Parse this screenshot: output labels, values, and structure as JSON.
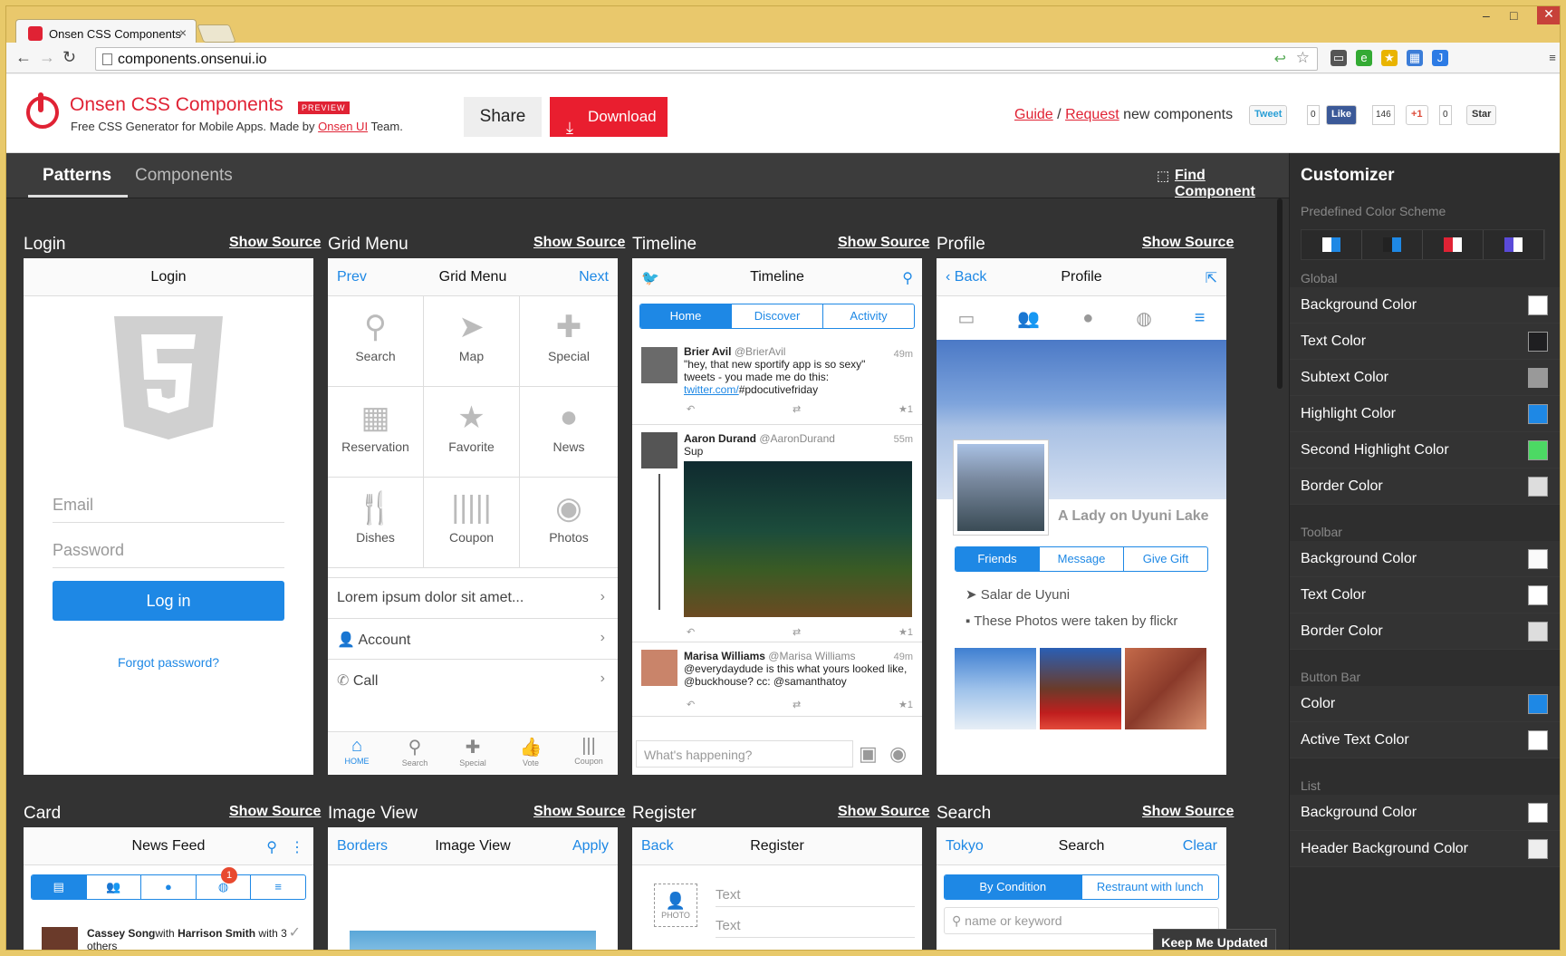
{
  "browser": {
    "tab_title": "Onsen CSS Components",
    "url": "components.onsenui.io"
  },
  "header": {
    "brand": "Onsen CSS Components",
    "preview": "PREVIEW",
    "tag_pre": "Free CSS Generator for Mobile Apps. Made by ",
    "tag_link": "Onsen UI",
    "tag_post": " Team.",
    "share": "Share",
    "download": "Download",
    "guide": "Guide",
    "sep": "/",
    "request": "Request",
    "request_post": " new components",
    "tweet": "Tweet",
    "tweet_count": "0",
    "like": "Like",
    "like_count": "146",
    "gplus": "+1",
    "gplus_count": "0",
    "star": "Star"
  },
  "nav": {
    "patterns": "Patterns",
    "components": "Components",
    "find": "Find Component"
  },
  "sections": {
    "show_source": "Show Source",
    "login": "Login",
    "grid": "Grid Menu",
    "timeline": "Timeline",
    "profile": "Profile",
    "card": "Card",
    "image": "Image View",
    "register": "Register",
    "search": "Search"
  },
  "login": {
    "title": "Login",
    "email": "Email",
    "password": "Password",
    "button": "Log in",
    "forgot": "Forgot password?"
  },
  "grid": {
    "prev": "Prev",
    "title": "Grid Menu",
    "next": "Next",
    "cells": [
      "Search",
      "Map",
      "Special",
      "Reservation",
      "Favorite",
      "News",
      "Dishes",
      "Coupon",
      "Photos"
    ],
    "list": [
      "Lorem ipsum dolor sit amet...",
      "Account",
      "Call"
    ],
    "tabs": [
      "HOME",
      "Search",
      "Special",
      "Vote",
      "Coupon"
    ]
  },
  "timeline": {
    "title": "Timeline",
    "segs": [
      "Home",
      "Discover",
      "Activity"
    ],
    "t1_name": "Brier Avil",
    "t1_handle": "@BrierAvil",
    "t1_time": "49m",
    "t1_text": "\"hey, that new sportify app is so sexy\" tweets - you made me do this:",
    "t1_link": "twitter.com/",
    "t1_tag": "#pdocutivefriday",
    "t2_name": "Aaron Durand",
    "t2_handle": "@AaronDurand",
    "t2_time": "55m",
    "t2_text": "Sup",
    "t3_name": "Marisa Williams",
    "t3_handle": "@Marisa Williams",
    "t3_time": "49m",
    "t3_text": "@everydaydude is this what yours looked like, @buckhouse? cc: @samanthatoy",
    "compose": "What's happening?",
    "star1": "★1"
  },
  "profile": {
    "back": "Back",
    "title": "Profile",
    "name": "A Lady on Uyuni Lake",
    "segs": [
      "Friends",
      "Message",
      "Give Gift"
    ],
    "loc": "Salar de Uyuni",
    "photos": "These Photos were taken by flickr"
  },
  "card": {
    "title": "News Feed",
    "badge": "1",
    "author": "Cassey Song",
    "with": "with",
    "other": "Harrison Smith",
    "tail": "with 3 others"
  },
  "imageview": {
    "left": "Borders",
    "title": "Image View",
    "right": "Apply"
  },
  "register": {
    "back": "Back",
    "title": "Register",
    "photo": "PHOTO",
    "f1": "Text",
    "f2": "Text"
  },
  "search": {
    "left": "Tokyo",
    "title": "Search",
    "right": "Clear",
    "segs": [
      "By Condition",
      "Restraunt with lunch"
    ],
    "placeholder": "name or keyword"
  },
  "customizer": {
    "title": "Customizer",
    "scheme_label": "Predefined Color Scheme",
    "global": "Global",
    "toolbar": "Toolbar",
    "buttonbar": "Button Bar",
    "list": "List",
    "global_rows": [
      {
        "label": "Background Color",
        "color": "#ffffff"
      },
      {
        "label": "Text Color",
        "color": "#1f1f21"
      },
      {
        "label": "Subtext Color",
        "color": "#999999"
      },
      {
        "label": "Highlight Color",
        "color": "#1e88e5"
      },
      {
        "label": "Second Highlight Color",
        "color": "#4cd964"
      },
      {
        "label": "Border Color",
        "color": "#dddddd"
      }
    ],
    "toolbar_rows": [
      {
        "label": "Background Color",
        "color": "#fafafa"
      },
      {
        "label": "Text Color",
        "color": "#ffffff"
      },
      {
        "label": "Border Color",
        "color": "#dddddd"
      }
    ],
    "buttonbar_rows": [
      {
        "label": "Color",
        "color": "#1e88e5"
      },
      {
        "label": "Active Text Color",
        "color": "#ffffff"
      }
    ],
    "list_rows": [
      {
        "label": "Background Color",
        "color": "#ffffff"
      },
      {
        "label": "Header Background Color",
        "color": "#eeeeee"
      }
    ]
  },
  "keep": "Keep Me Updated"
}
